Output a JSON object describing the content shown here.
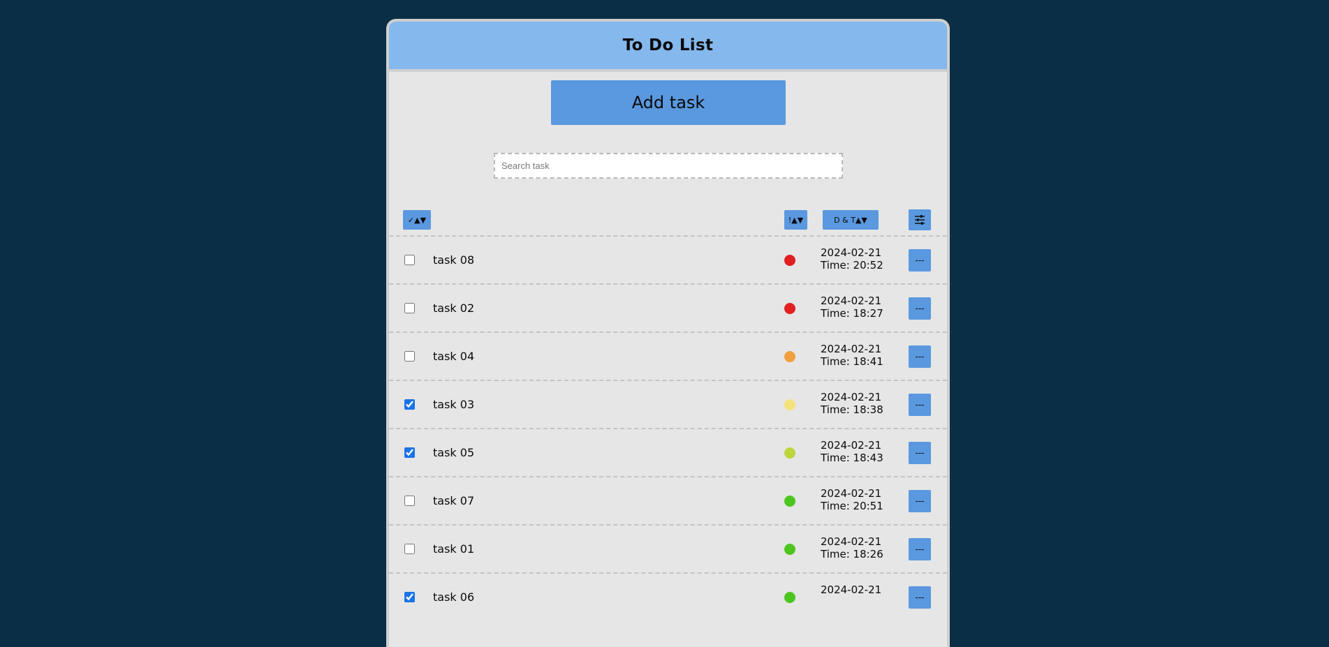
{
  "header": {
    "title": "To Do List"
  },
  "toolbar": {
    "add_label": "Add task"
  },
  "search": {
    "placeholder": "Search task",
    "value": ""
  },
  "columns": {
    "check_sort_label": "✓▲▼",
    "priority_sort_label": "!▲▼",
    "date_sort_label": "D & T▲▼",
    "filter_icon": "sliders-icon"
  },
  "tasks": [
    {
      "name": "task 08",
      "done": false,
      "priority_color": "#e02020",
      "date": "2024-02-21",
      "time": "Time: 20:52",
      "menu_label": "---"
    },
    {
      "name": "task 02",
      "done": false,
      "priority_color": "#e02020",
      "date": "2024-02-21",
      "time": "Time: 18:27",
      "menu_label": "---"
    },
    {
      "name": "task 04",
      "done": false,
      "priority_color": "#f0a03c",
      "date": "2024-02-21",
      "time": "Time: 18:41",
      "menu_label": "---"
    },
    {
      "name": "task 03",
      "done": true,
      "priority_color": "#f5e27a",
      "date": "2024-02-21",
      "time": "Time: 18:38",
      "menu_label": "---"
    },
    {
      "name": "task 05",
      "done": true,
      "priority_color": "#bcd63e",
      "date": "2024-02-21",
      "time": "Time: 18:43",
      "menu_label": "---"
    },
    {
      "name": "task 07",
      "done": false,
      "priority_color": "#4cc61e",
      "date": "2024-02-21",
      "time": "Time: 20:51",
      "menu_label": "---"
    },
    {
      "name": "task 01",
      "done": false,
      "priority_color": "#4cc61e",
      "date": "2024-02-21",
      "time": "Time: 18:26",
      "menu_label": "---"
    },
    {
      "name": "task 06",
      "done": true,
      "priority_color": "#4cc61e",
      "date": "2024-02-21",
      "time": "",
      "menu_label": "---"
    }
  ],
  "colors": {
    "background": "#0b2e47",
    "header": "#85b8ec",
    "panel": "#e6e6e6",
    "button": "#5a98df"
  }
}
